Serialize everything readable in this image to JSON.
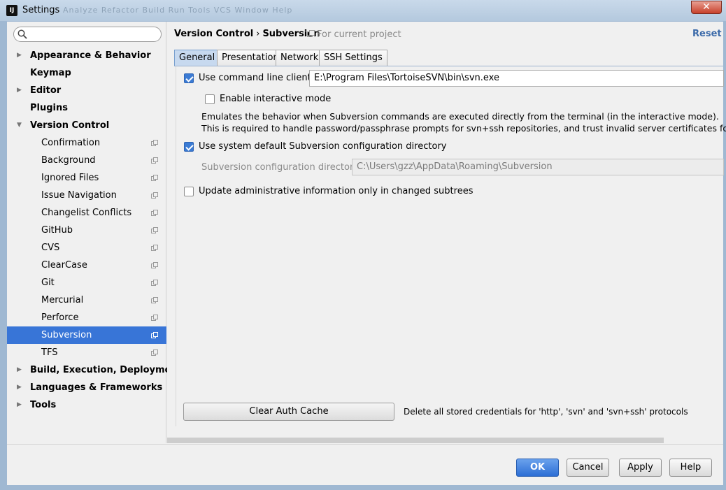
{
  "window": {
    "title": "Settings",
    "app_icon_text": "IJ",
    "ghost_menu": "Analyze  Refactor  Build  Run  Tools  VCS  Window  Help",
    "close_label": "✕"
  },
  "search": {
    "placeholder": ""
  },
  "sidebar": {
    "items": [
      {
        "label": "Appearance & Behavior",
        "level": 0,
        "arrow": "▶"
      },
      {
        "label": "Keymap",
        "level": 0,
        "arrow": ""
      },
      {
        "label": "Editor",
        "level": 0,
        "arrow": "▶"
      },
      {
        "label": "Plugins",
        "level": 0,
        "arrow": ""
      },
      {
        "label": "Version Control",
        "level": 0,
        "arrow": "▼"
      },
      {
        "label": "Confirmation",
        "level": 1
      },
      {
        "label": "Background",
        "level": 1
      },
      {
        "label": "Ignored Files",
        "level": 1
      },
      {
        "label": "Issue Navigation",
        "level": 1
      },
      {
        "label": "Changelist Conflicts",
        "level": 1
      },
      {
        "label": "GitHub",
        "level": 1
      },
      {
        "label": "CVS",
        "level": 1
      },
      {
        "label": "ClearCase",
        "level": 1
      },
      {
        "label": "Git",
        "level": 1
      },
      {
        "label": "Mercurial",
        "level": 1
      },
      {
        "label": "Perforce",
        "level": 1
      },
      {
        "label": "Subversion",
        "level": 1,
        "selected": true
      },
      {
        "label": "TFS",
        "level": 1
      },
      {
        "label": "Build, Execution, Deployment",
        "level": 0,
        "arrow": "▶"
      },
      {
        "label": "Languages & Frameworks",
        "level": 0,
        "arrow": "▶"
      },
      {
        "label": "Tools",
        "level": 0,
        "arrow": "▶"
      }
    ]
  },
  "header": {
    "crumb_parent": "Version Control",
    "crumb_separator": "›",
    "crumb_current": "Subversion",
    "for_project": "For current project",
    "reset_label": "Reset"
  },
  "tabs": [
    {
      "label": "General",
      "active": true
    },
    {
      "label": "Presentation"
    },
    {
      "label": "Network"
    },
    {
      "label": "SSH Settings"
    }
  ],
  "general": {
    "use_cmd_client_label": "Use command line client:",
    "use_cmd_client_checked": true,
    "cmd_client_path": "E:\\Program Files\\TortoiseSVN\\bin\\svn.exe",
    "interactive_label": "Enable interactive mode",
    "interactive_checked": false,
    "interactive_desc_1": "Emulates the behavior when Subversion commands are executed directly from the terminal (in the interactive mode).",
    "interactive_desc_2": "This is required to handle password/passphrase prompts for svn+ssh repositories, and trust invalid server certificates for https",
    "use_default_dir_label": "Use system default Subversion configuration directory",
    "use_default_dir_checked": true,
    "config_dir_label": "Subversion configuration directory:",
    "config_dir_value": "C:\\Users\\gzz\\AppData\\Roaming\\Subversion",
    "update_admin_label": "Update administrative information only in changed subtrees",
    "update_admin_checked": false,
    "clear_cache_label": "Clear Auth Cache",
    "clear_cache_desc": "Delete all stored credentials for 'http', 'svn' and 'svn+ssh' protocols"
  },
  "buttons": {
    "ok": "OK",
    "cancel": "Cancel",
    "apply": "Apply",
    "help": "Help"
  },
  "colors": {
    "accent": "#3875d7",
    "reset_link": "#3b6aa9"
  }
}
